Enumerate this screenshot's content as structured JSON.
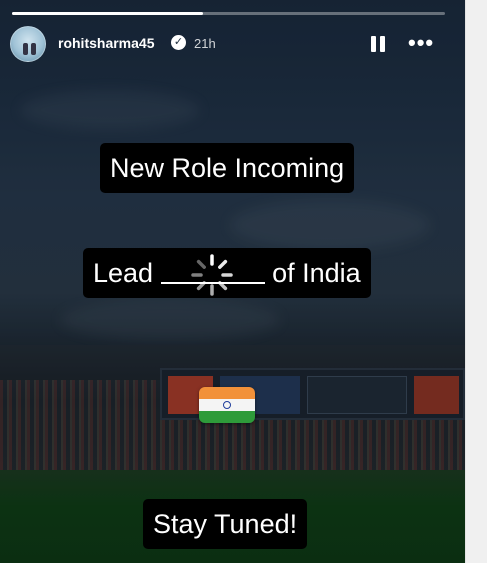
{
  "story": {
    "progress": 0.44,
    "username": "rohitsharma45",
    "verified_icon": "verified-badge-icon",
    "time_ago": "21h",
    "controls": {
      "pause_icon": "pause-icon",
      "more_icon": "more-dots-icon",
      "more_glyph": "•••"
    },
    "captions": {
      "line1": "New Role Incoming",
      "line2_prefix": "Lead",
      "line2_suffix": "of India",
      "line3": "Stay Tuned!"
    },
    "decorations": {
      "loading_sticker": "loading-spinner-icon",
      "flag_emoji": "india-flag-icon"
    }
  }
}
